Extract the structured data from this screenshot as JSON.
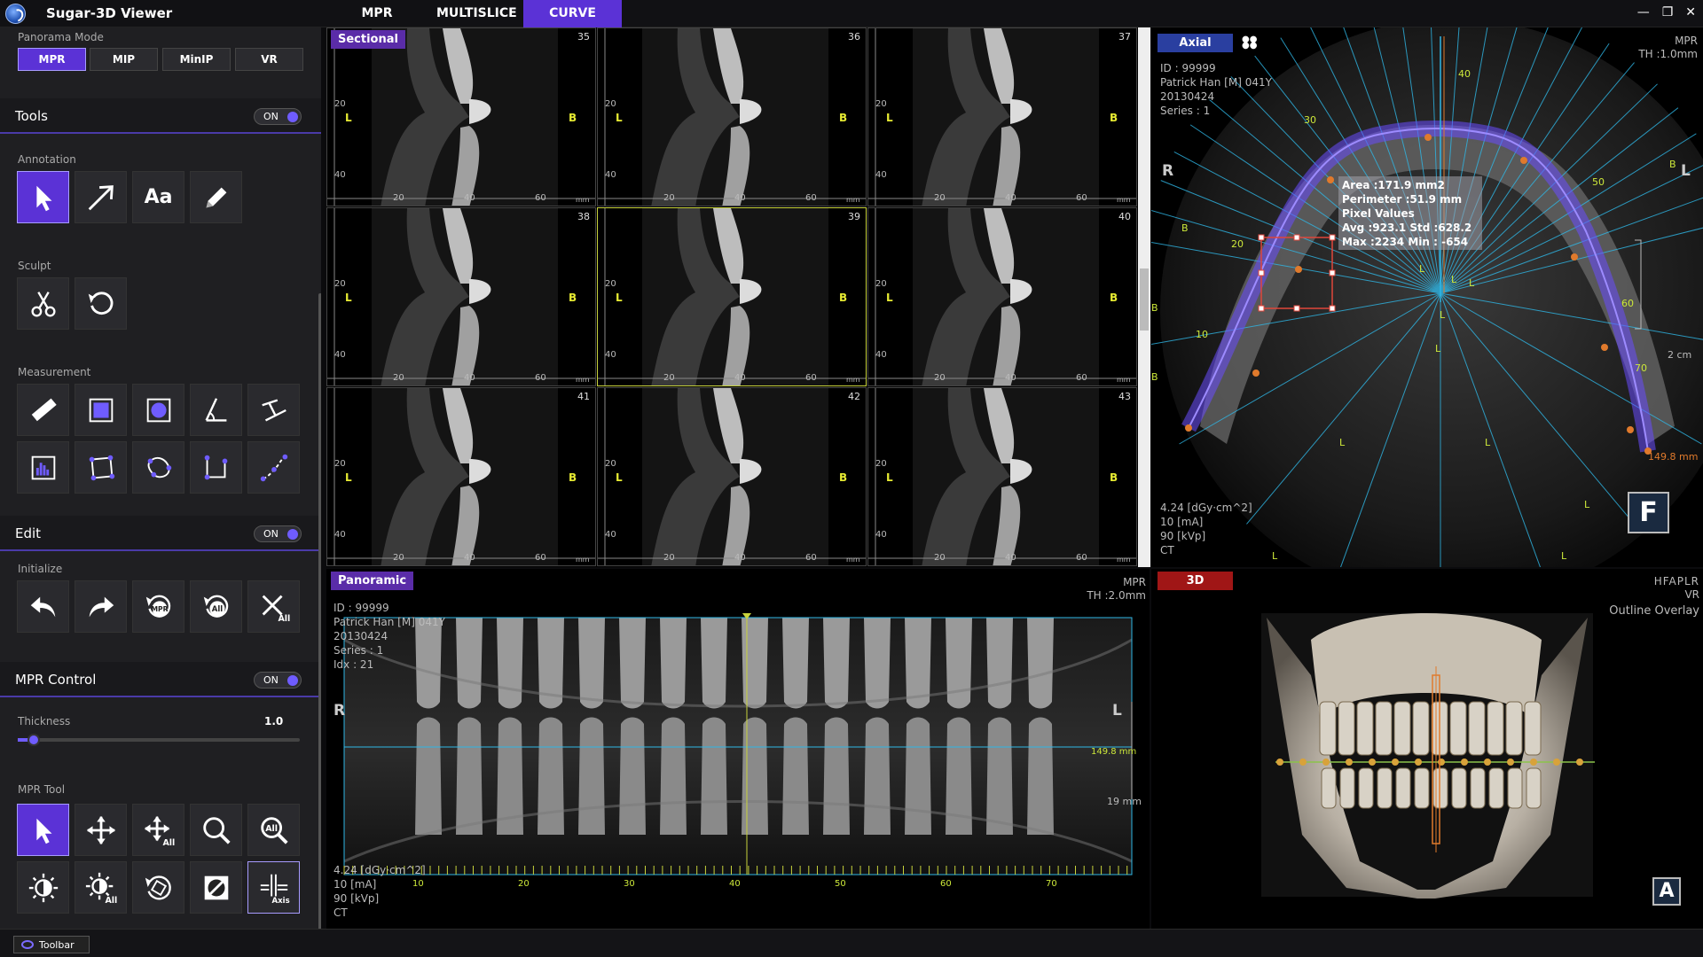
{
  "app": {
    "title": "Sugar-3D Viewer",
    "tabs": [
      "MPR",
      "MULTISLICE",
      "CURVE"
    ],
    "active_tab": "CURVE",
    "window_controls": [
      "minimize",
      "restore",
      "close"
    ]
  },
  "left_panel": {
    "panorama_mode": {
      "label": "Panorama Mode",
      "modes": [
        "MPR",
        "MIP",
        "MinIP",
        "VR"
      ],
      "active": "MPR"
    },
    "tools": {
      "title": "Tools",
      "toggle": "ON",
      "annotation_label": "Annotation",
      "annotation_text_glyph": "Aa",
      "sculpt_label": "Sculpt",
      "measurement_label": "Measurement"
    },
    "edit": {
      "title": "Edit",
      "toggle": "ON",
      "initialize_label": "Initialize",
      "badge_mpr": "MPR",
      "badge_all": "All"
    },
    "mpr_control": {
      "title": "MPR Control",
      "toggle": "ON",
      "thickness_label": "Thickness",
      "thickness_value": "1.0",
      "thickness_fraction": 0.04,
      "mpr_tool_label": "MPR Tool",
      "badge_all": "All",
      "badge_axis": "Axis"
    }
  },
  "sectional": {
    "label": "Sectional",
    "cells": [
      {
        "num": "35",
        "selected": false
      },
      {
        "num": "36",
        "selected": false
      },
      {
        "num": "37",
        "selected": false
      },
      {
        "num": "38",
        "selected": false
      },
      {
        "num": "39",
        "selected": true
      },
      {
        "num": "40",
        "selected": false
      },
      {
        "num": "41",
        "selected": false
      },
      {
        "num": "42",
        "selected": false
      },
      {
        "num": "43",
        "selected": false
      }
    ],
    "left_marker": "L",
    "right_marker": "B",
    "side_ticks": [
      "20",
      "40"
    ],
    "bottom_ticks": [
      "20",
      "40",
      "60"
    ],
    "unit": "mm"
  },
  "axial": {
    "label": "Axial",
    "patient": {
      "id": "ID : 99999",
      "name": "Patrick Han  [M] 041Y",
      "date": "20130424",
      "series": "Series : 1"
    },
    "mode": "MPR",
    "thickness": "TH :1.0mm",
    "orient_left": "R",
    "orient_right": "L",
    "dose": {
      "dap": "4.24  [dGy·cm^2]",
      "ma": "10 [mA]",
      "kvp": "90 [kVp]",
      "modality": "CT"
    },
    "measurement": {
      "area": "Area :171.9  mm2",
      "perimeter": "Perimeter :51.9 mm",
      "pixel_values": "Pixel Values",
      "avg_std": "Avg :923.1 Std :628.2",
      "max_min": "Max :2234   Min : -654"
    },
    "curve_length": "149.8 mm",
    "scale": "2 cm",
    "badge": "F",
    "angles": [
      "40",
      "30",
      "50",
      "20",
      "60",
      "10",
      "70"
    ],
    "side_marks": [
      "B",
      "B",
      "B",
      "B",
      "L",
      "L",
      "L",
      "L",
      "L",
      "L",
      "L",
      "L",
      "L",
      "L"
    ]
  },
  "panoramic": {
    "label": "Panoramic",
    "patient": {
      "id": "ID : 99999",
      "name": "Patrick Han  [M] 041Y",
      "date": "20130424",
      "series": "Series : 1",
      "idx": "Idx : 21"
    },
    "mode": "MPR",
    "thickness": "TH :2.0mm",
    "orient_left": "R",
    "orient_right": "L",
    "length": "149.8 mm",
    "depth": "19 mm",
    "ticks": [
      "10",
      "20",
      "30",
      "40",
      "50",
      "60",
      "70"
    ],
    "dose": {
      "dap": "4.24  [dGy·cm^2]",
      "ma": "10 [mA]",
      "kvp": "90 [kVp]",
      "modality": "CT"
    }
  },
  "vr3d": {
    "label": "3D",
    "orient": "HFAPLR",
    "mode": "VR",
    "overlay": "Outline Overlay",
    "badge": "A"
  },
  "bottom": {
    "toolbar_label": "Toolbar"
  },
  "colors": {
    "accent": "#5b32d6",
    "curve_tab": "#5b32d6",
    "sectional_label": "#5a2ca8",
    "axial_label": "#2a3fa0",
    "panoramic_label": "#5a2ca8",
    "vr_label": "#a01616",
    "marker_yellow": "#e6ea32",
    "guide_cyan": "#2fb7e6"
  }
}
